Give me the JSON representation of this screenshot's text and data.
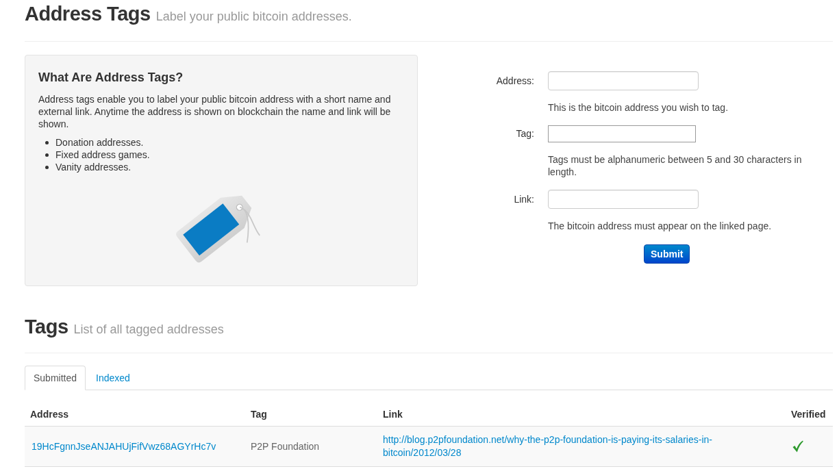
{
  "header": {
    "title": "Address Tags",
    "subtitle": "Label your public bitcoin addresses."
  },
  "info": {
    "title": "What Are Address Tags?",
    "text": "Address tags enable you to label your public bitcoin address with a short name and external link. Anytime the address is shown on blockchain the name and link will be shown.",
    "items": [
      "Donation addresses.",
      "Fixed address games.",
      "Vanity addresses."
    ]
  },
  "form": {
    "fields": [
      {
        "label": "Address:",
        "kind": "rounded",
        "help": "This is the bitcoin address you wish to tag."
      },
      {
        "label": "Tag:",
        "kind": "square",
        "help": "Tags must be alphanumeric between 5 and 30 characters in length."
      },
      {
        "label": "Link:",
        "kind": "rounded",
        "help": "The bitcoin address must appear on the linked page."
      }
    ],
    "submit": "Submit"
  },
  "tags_section": {
    "title": "Tags",
    "subtitle": "List of all tagged addresses"
  },
  "tabs": [
    {
      "label": "Submitted",
      "selected": true
    },
    {
      "label": "Indexed",
      "selected": false
    }
  ],
  "table": {
    "columns": [
      "Address",
      "Tag",
      "Link",
      "Verified"
    ],
    "rows": [
      {
        "address": "19HcFgnnJseANJAHUjFifVwz68AGYrHc7v",
        "tag": "P2P Foundation",
        "link": "http://blog.p2pfoundation.net/why-the-p2p-foundation-is-paying-its-salaries-in-bitcoin/2012/03/28",
        "verified": true
      }
    ]
  }
}
